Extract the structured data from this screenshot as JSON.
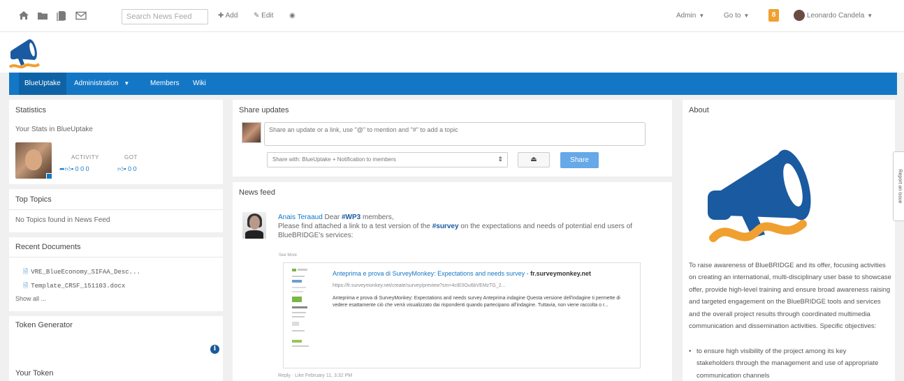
{
  "topbar": {
    "search_placeholder": "Search News Feed",
    "add_label": "Add",
    "edit_label": "Edit",
    "admin_label": "Admin",
    "goto_label": "Go to",
    "user_name": "Leonardo Candela",
    "notif_count": "8"
  },
  "nav": {
    "items": [
      "BlueUptake",
      "Administration",
      "Members",
      "Wiki"
    ]
  },
  "statistics": {
    "title": "Statistics",
    "subtitle": "Your Stats in BlueUptake",
    "activity_label": "ACTIVITY",
    "got_label": "GOT",
    "activity_values": "0  0  0",
    "got_values": "0  0"
  },
  "top_topics": {
    "title": "Top Topics",
    "empty_text": "No Topics found in News Feed"
  },
  "recent_documents": {
    "title": "Recent Documents",
    "items": [
      "VRE_BlueEconomy_SIFAA_Desc...",
      "Template_CRSF_151103.docx"
    ],
    "show_all": "Show all ..."
  },
  "token": {
    "title": "Token Generator",
    "your_token": "Your Token"
  },
  "share": {
    "title": "Share updates",
    "placeholder": "Share an update or a link, use \"@\" to mention and \"#\" to add a topic",
    "visibility": "Share with: BlueUptake + Notification to members",
    "button": "Share"
  },
  "newsfeed": {
    "title": "News feed",
    "post": {
      "author": "Anais Teraaud",
      "text_pre": "Dear",
      "tag1": "#WP3",
      "text_mid": "members,",
      "text2": "Please find attached a link to a test version of the",
      "tag2": "#survey",
      "text3": "on the expectations and needs of potential end users of BlueBRIDGE's services:",
      "see_more": "See More",
      "preview_title": "Anteprima e prova di SurveyMonkey: Expectations and needs survey -",
      "preview_domain": "fr.surveymonkey.net",
      "preview_url": "https://fr.surveymonkey.net/create/survey/preview?sm=4cIE0Ou6bVEMzTG_2...",
      "preview_desc": "Anteprima e prova di SurveyMonkey: Expectations and needs survey Anteprima indagine Questa versione dell'indagine ti permette di vedere esattamente ciò che verrà visualizzato dai rispondenti quando partecipano all'indagine. Tuttavia, non viene raccolta o r...",
      "footer": "Reply  ·  Like      February 11, 3:32 PM"
    }
  },
  "about": {
    "title": "About",
    "text": "To raise awareness of BlueBRIDGE and its offer, focusing activities on creating an international, multi-disciplinary user base to showcase offer, provide high-level training and ensure broad awareness raising and targeted engagement on the BlueBRIDGE tools and services and the overall project results through coordinated multimedia communication and dissemination activities. Specific objectives:",
    "bullet": "to ensure high visibility of the project among its key stakeholders through the management and use of appropriate communication channels"
  },
  "report_issue": "Report an issue",
  "colors": {
    "brand_blue": "#1377c6",
    "megaphone_orange": "#f0a030"
  }
}
